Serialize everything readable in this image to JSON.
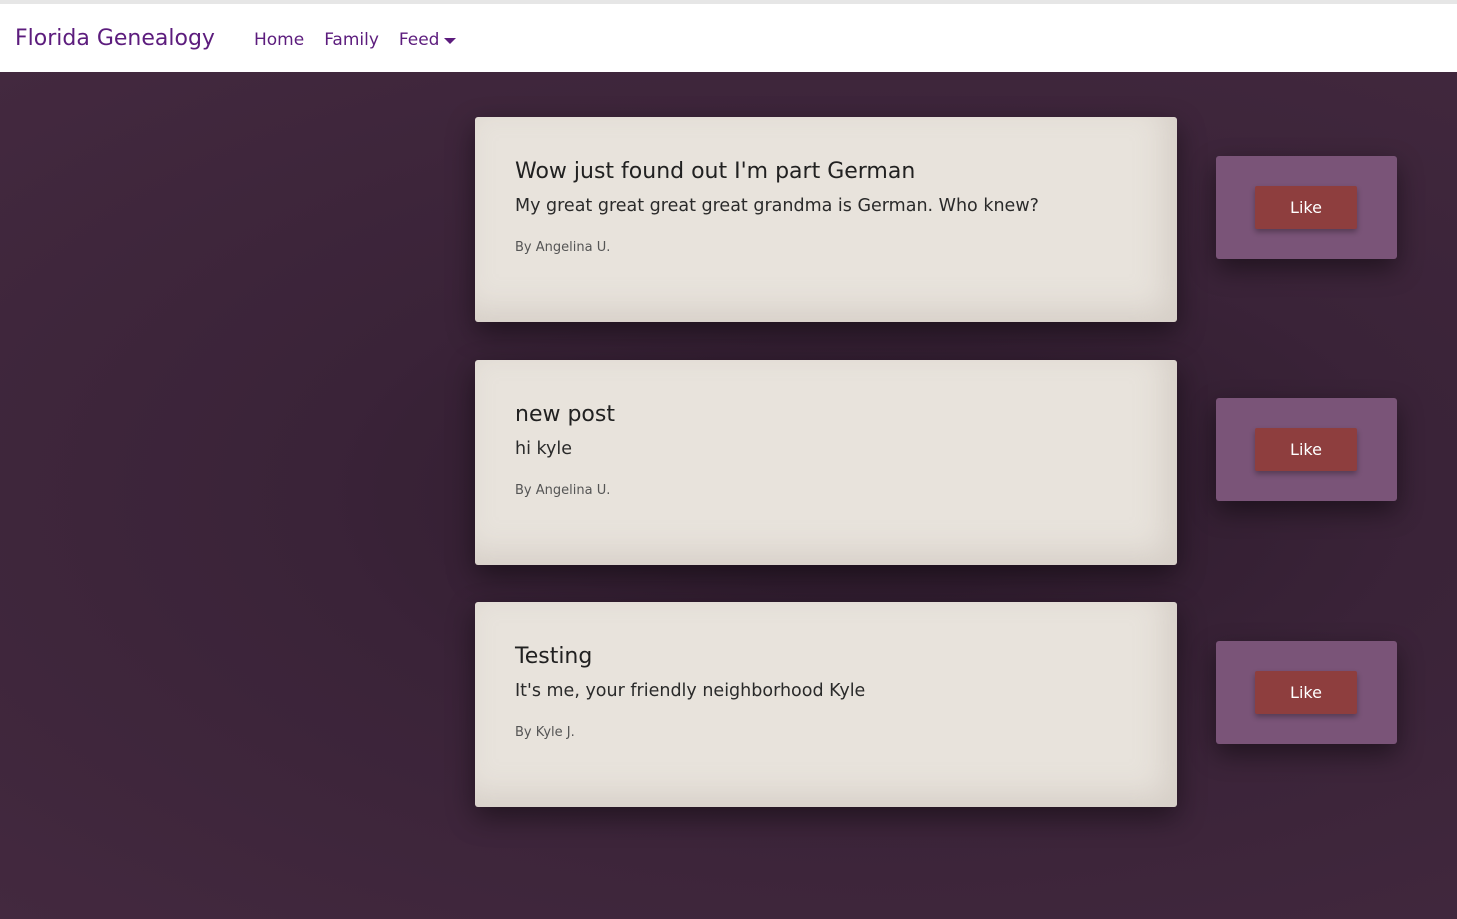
{
  "navbar": {
    "brand": "Florida Genealogy",
    "links": [
      {
        "label": "Home"
      },
      {
        "label": "Family"
      }
    ],
    "dropdown": {
      "label": "Feed"
    }
  },
  "posts": [
    {
      "title": "Wow just found out I'm part German",
      "body": "My great great great great grandma is German. Who knew?",
      "author": "By Angelina U.",
      "like_label": "Like"
    },
    {
      "title": "new post",
      "body": "hi kyle",
      "author": "By Angelina U.",
      "like_label": "Like"
    },
    {
      "title": "Testing",
      "body": "It's me, your friendly neighborhood Kyle",
      "author": "By Kyle J.",
      "like_label": "Like"
    }
  ],
  "colors": {
    "brand": "#5c1c7d",
    "background": "#42283f",
    "card": "#e8e3dc",
    "like_panel": "#7a5478",
    "like_button": "#8e3e3e"
  }
}
